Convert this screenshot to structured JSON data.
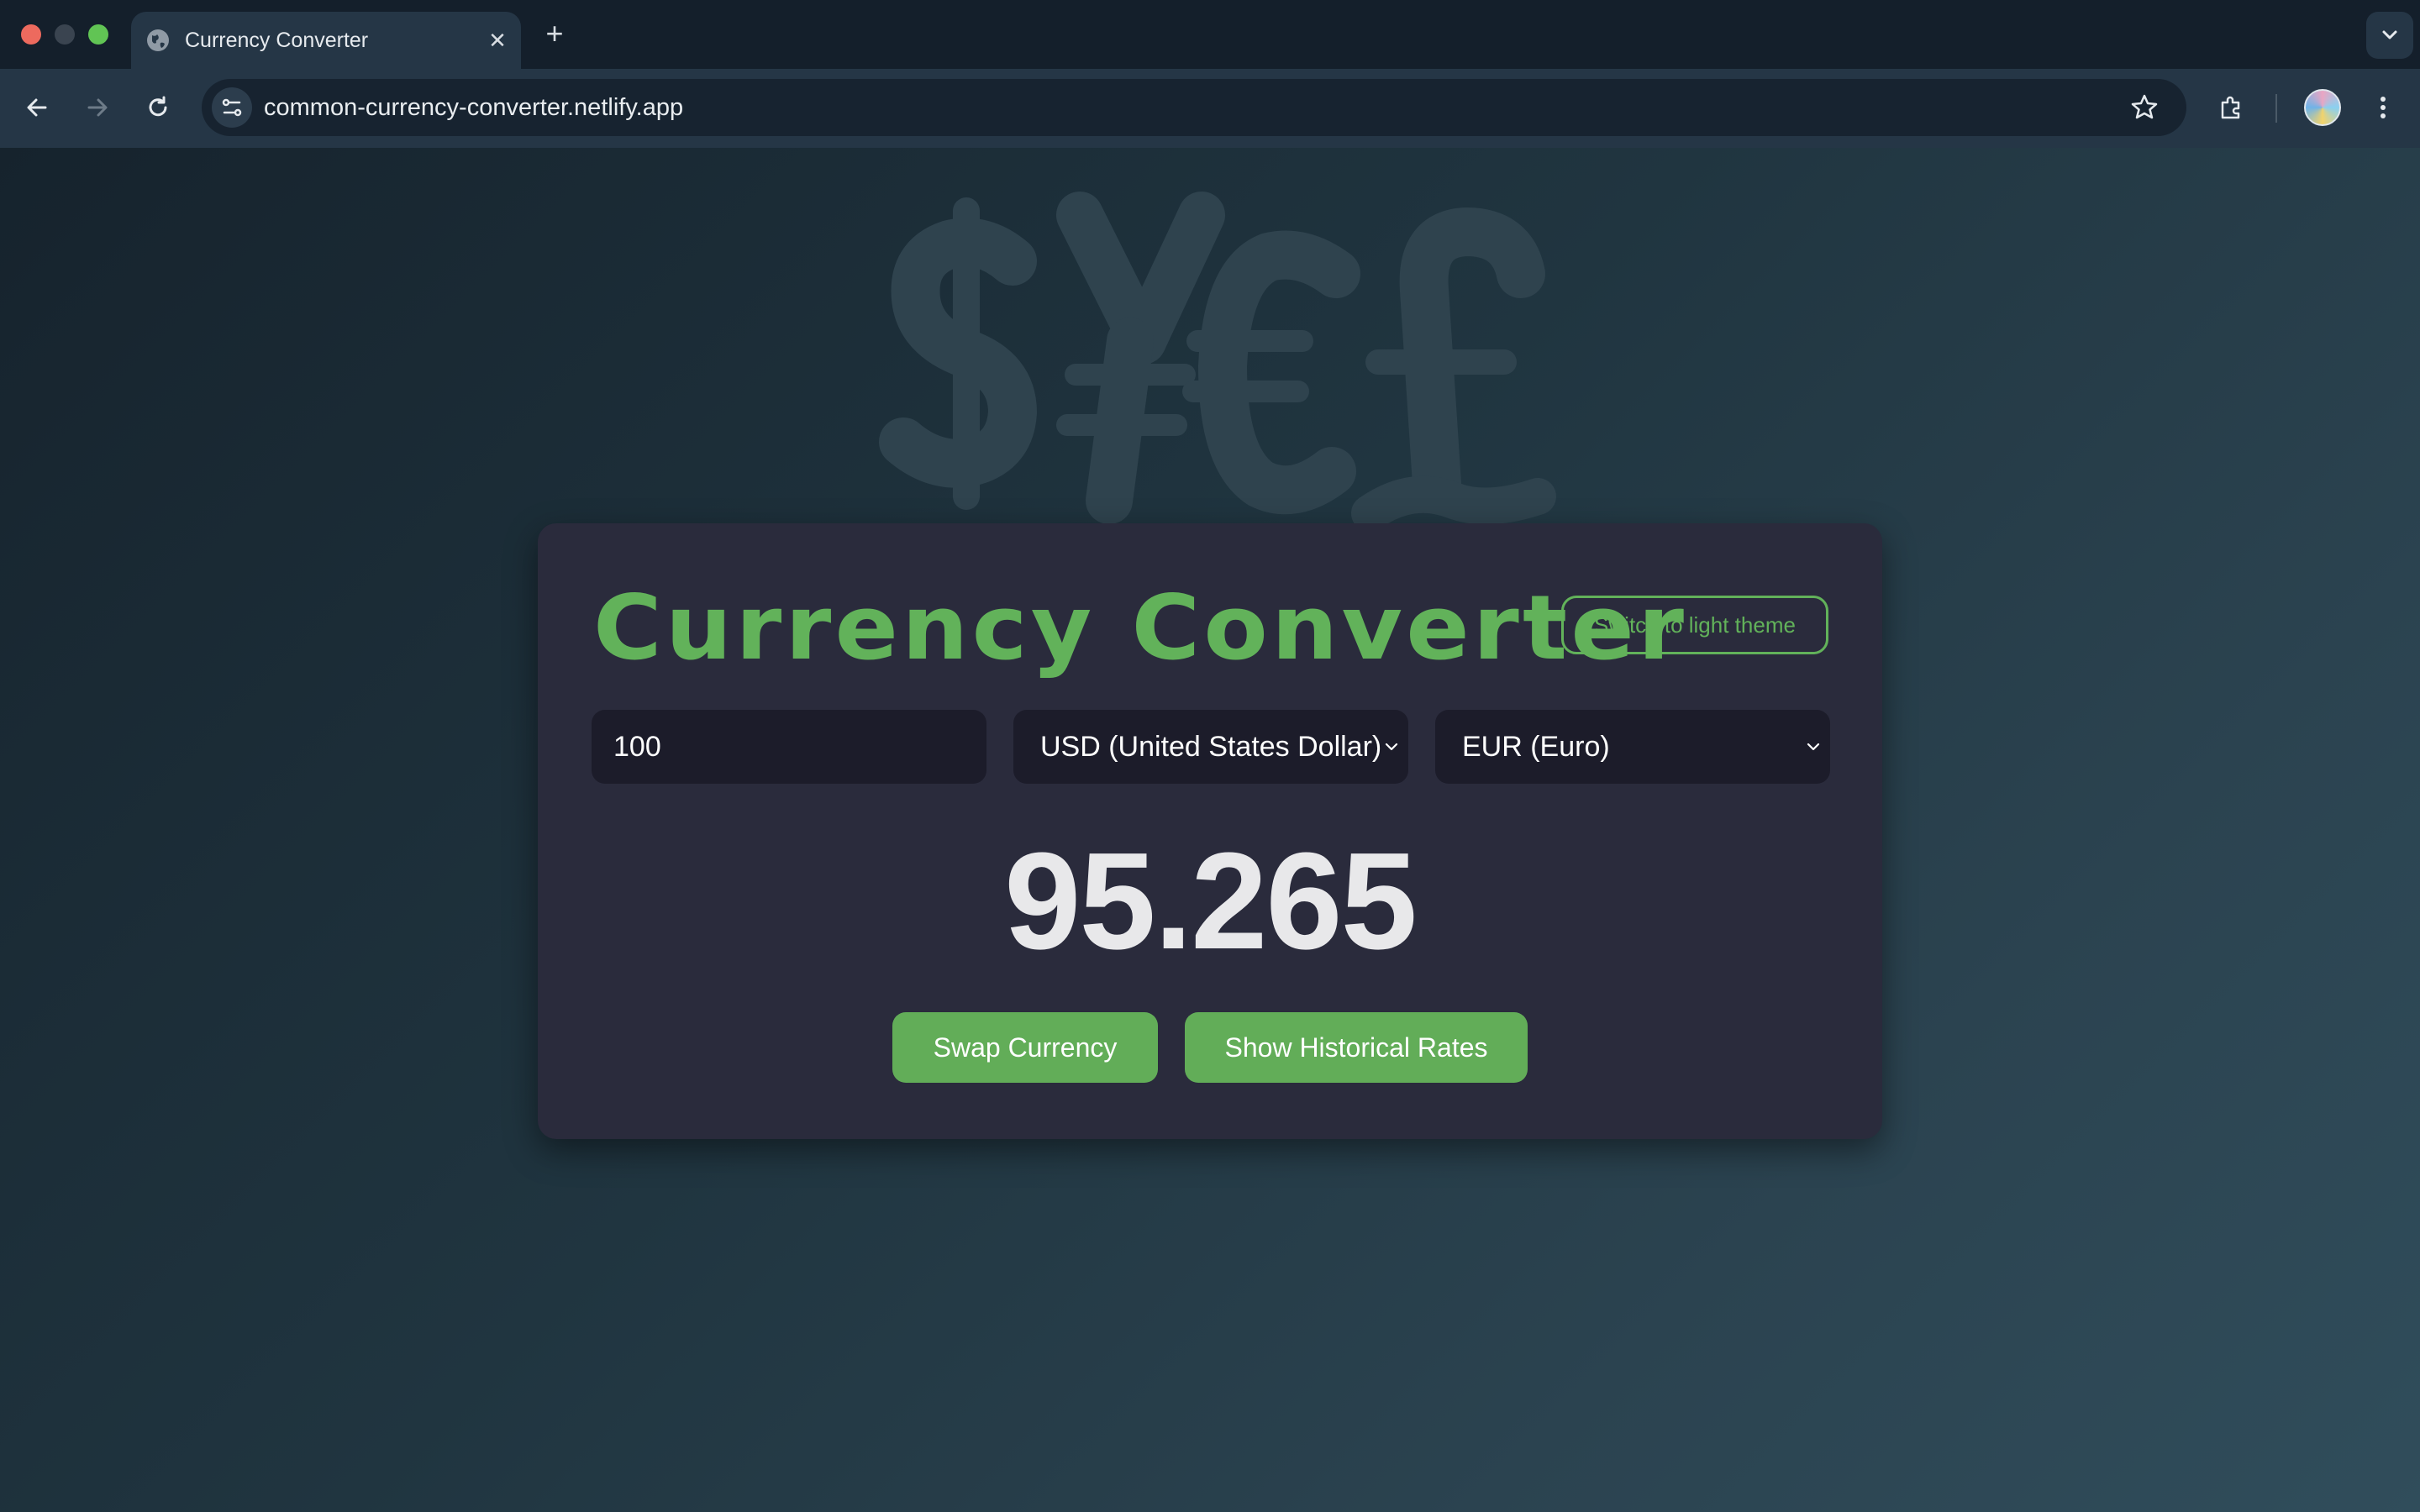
{
  "browser": {
    "tab_title": "Currency Converter",
    "url": "common-currency-converter.netlify.app",
    "new_tab_symbol": "+",
    "close_symbol": "✕",
    "colors": {
      "tabstrip": "#141f2b",
      "toolbar": "#253646"
    },
    "icons": [
      "globe-icon",
      "close-icon",
      "plus-icon",
      "chevron-down-icon",
      "back-arrow-icon",
      "forward-arrow-icon",
      "reload-icon",
      "site-info-icon",
      "star-icon",
      "extensions-icon",
      "avatar",
      "kebab-menu-icon"
    ]
  },
  "app": {
    "title": "Currency Converter",
    "theme_toggle_label": "Switch to light theme",
    "amount_value": "100",
    "from_currency": "USD (United States Dollar)",
    "to_currency": "EUR (Euro)",
    "result": "95.265",
    "swap_label": "Swap Currency",
    "history_label": "Show Historical Rates",
    "colors": {
      "accent": "#62b25a",
      "card": "#2a2b3c",
      "field": "#1c1c2a",
      "button": "#62ad58"
    }
  }
}
